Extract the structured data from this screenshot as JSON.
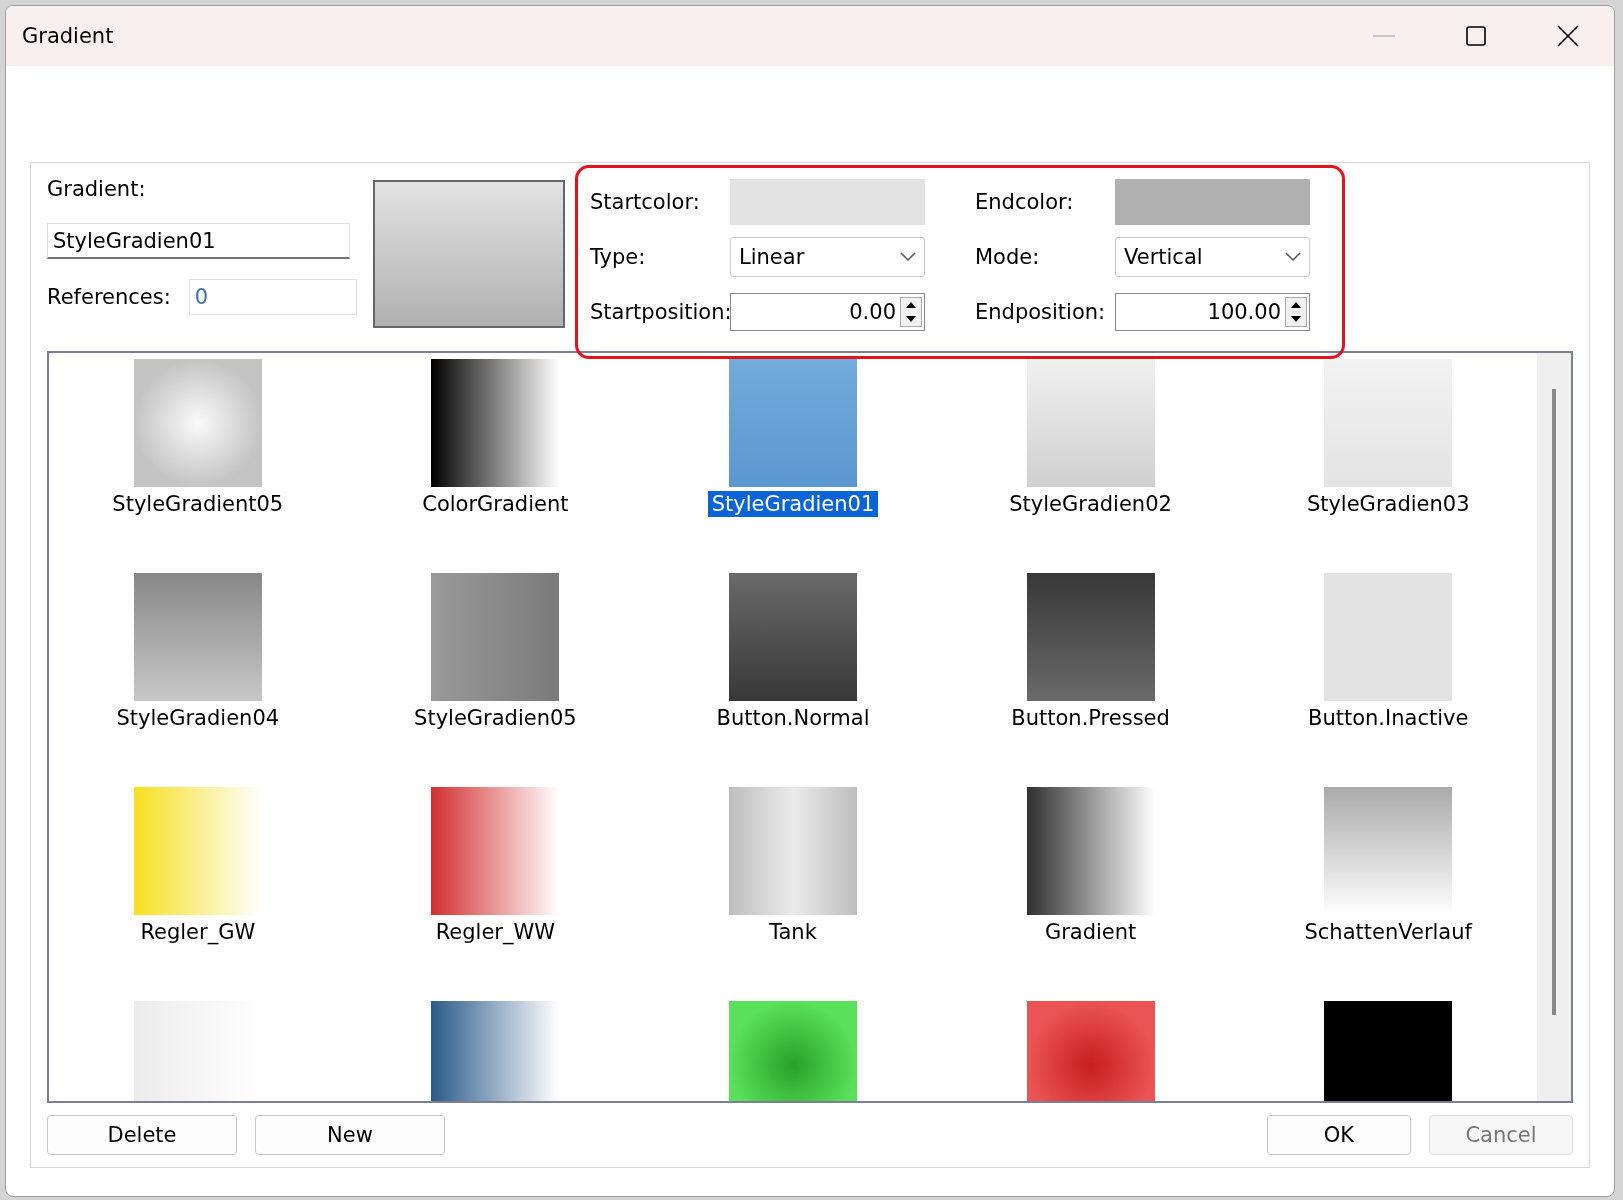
{
  "window": {
    "title": "Gradient"
  },
  "form": {
    "gradient_label": "Gradient:",
    "name_value": "StyleGradien01",
    "references_label": "References:",
    "references_value": "0",
    "preview": {
      "stops": [
        {
          "color": "#e3e3e3"
        },
        {
          "color": "#b0b0b0"
        }
      ]
    },
    "startcolor_label": "Startcolor:",
    "startcolor_swatch": {
      "color": "#e3e3e3"
    },
    "endcolor_label": "Endcolor:",
    "endcolor_swatch": {
      "color": "#b0b0b0"
    },
    "type_label": "Type:",
    "type_value": "Linear",
    "mode_label": "Mode:",
    "mode_value": "Vertical",
    "startposition_label": "Startposition:",
    "startposition_value": "0.00",
    "endposition_label": "Endposition:",
    "endposition_value": "100.00"
  },
  "gradients": [
    {
      "label": "StyleGradient05",
      "kind": "radial",
      "stops": [
        {
          "color": "#fafafa"
        },
        {
          "color": "#c4c4c4"
        }
      ],
      "selected": false
    },
    {
      "label": "ColorGradient",
      "kind": "horizontal",
      "stops": [
        {
          "color": "#000000"
        },
        {
          "color": "#ffffff"
        }
      ],
      "selected": false
    },
    {
      "label": "StyleGradien01",
      "kind": "vertical",
      "stops": [
        {
          "color": "#72abdc"
        },
        {
          "color": "#5b97cf"
        }
      ],
      "selected": true
    },
    {
      "label": "StyleGradien02",
      "kind": "vertical",
      "stops": [
        {
          "color": "#f0f0f0"
        },
        {
          "color": "#d0d0d0"
        }
      ],
      "selected": false
    },
    {
      "label": "StyleGradien03",
      "kind": "vertical",
      "stops": [
        {
          "color": "#f2f2f2"
        },
        {
          "color": "#e4e4e4"
        }
      ],
      "selected": false
    },
    {
      "label": "StyleGradien04",
      "kind": "vertical",
      "stops": [
        {
          "color": "#888888"
        },
        {
          "color": "#c8c8c8"
        }
      ],
      "selected": false
    },
    {
      "label": "StyleGradien05",
      "kind": "horizontal",
      "stops": [
        {
          "color": "#9a9a9a"
        },
        {
          "color": "#7a7a7a"
        }
      ],
      "selected": false
    },
    {
      "label": "Button.Normal",
      "kind": "vertical",
      "stops": [
        {
          "color": "#6a6a6a"
        },
        {
          "color": "#383838"
        }
      ],
      "selected": false
    },
    {
      "label": "Button.Pressed",
      "kind": "vertical",
      "stops": [
        {
          "color": "#383838"
        },
        {
          "color": "#6a6a6a"
        }
      ],
      "selected": false
    },
    {
      "label": "Button.Inactive",
      "kind": "vertical",
      "stops": [
        {
          "color": "#e3e3e3"
        },
        {
          "color": "#e3e3e3"
        }
      ],
      "selected": false
    },
    {
      "label": "Regler_GW",
      "kind": "horizontal",
      "stops": [
        {
          "color": "#f5e020"
        },
        {
          "color": "#ffffff"
        }
      ],
      "selected": false
    },
    {
      "label": "Regler_WW",
      "kind": "horizontal",
      "stops": [
        {
          "color": "#d03030"
        },
        {
          "color": "#ffffff"
        }
      ],
      "selected": false
    },
    {
      "label": "Tank",
      "kind": "mirror",
      "stops": [
        {
          "color": "#bdbdbd"
        },
        {
          "color": "#ebebeb"
        }
      ],
      "selected": false
    },
    {
      "label": "Gradient",
      "kind": "horizontal",
      "stops": [
        {
          "color": "#303030"
        },
        {
          "color": "#ffffff"
        }
      ],
      "selected": false
    },
    {
      "label": "SchattenVerlauf",
      "kind": "vertical",
      "stops": [
        {
          "color": "#aaaaaa"
        },
        {
          "color": "#ffffff"
        }
      ],
      "selected": false
    },
    {
      "kind": "horizontal",
      "stops": [
        {
          "color": "#ececec"
        },
        {
          "color": "#ffffff"
        }
      ],
      "selected": false
    },
    {
      "kind": "horizontal",
      "stops": [
        {
          "color": "#2a5a8a"
        },
        {
          "color": "#ffffff"
        }
      ],
      "selected": false
    },
    {
      "kind": "radial",
      "stops": [
        {
          "color": "#28a028"
        },
        {
          "color": "#5ae05a"
        }
      ],
      "selected": false
    },
    {
      "kind": "radial",
      "stops": [
        {
          "color": "#c81e1e"
        },
        {
          "color": "#ea5454"
        }
      ],
      "selected": false
    },
    {
      "kind": "vertical",
      "stops": [
        {
          "color": "#000000"
        },
        {
          "color": "#000000"
        }
      ],
      "selected": false
    }
  ],
  "buttons": [
    {
      "label": "Delete",
      "disabled": false
    },
    {
      "label": "New",
      "disabled": false
    },
    {
      "label": "OK",
      "disabled": false
    },
    {
      "label": "Cancel",
      "disabled": true
    }
  ]
}
